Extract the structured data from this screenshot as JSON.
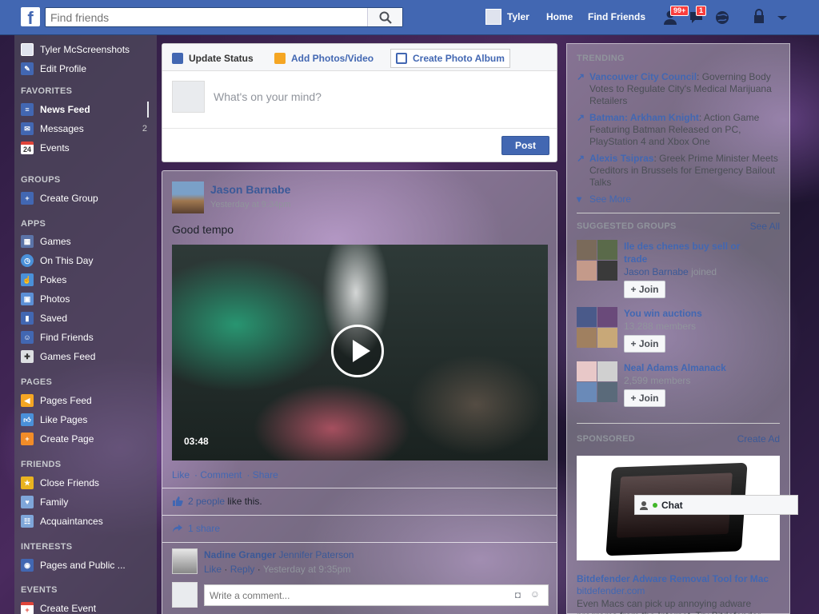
{
  "header": {
    "logo": "f",
    "search_placeholder": "Find friends",
    "user_name": "Tyler",
    "home": "Home",
    "find_friends": "Find Friends",
    "friend_requests_badge": "99+",
    "messages_badge": "1"
  },
  "sidebar": {
    "profile_name": "Tyler McScreenshots",
    "edit_profile": "Edit Profile",
    "favorites_heading": "FAVORITES",
    "favorites": [
      {
        "label": "News Feed",
        "icon": "news-feed-icon"
      },
      {
        "label": "Messages",
        "icon": "messages-icon",
        "count": "2"
      },
      {
        "label": "Events",
        "icon": "calendar-icon",
        "icon_text": "24"
      }
    ],
    "groups_heading": "GROUPS",
    "groups": [
      {
        "label": "Create Group",
        "icon": "plus-icon"
      }
    ],
    "apps_heading": "APPS",
    "apps": [
      {
        "label": "Games",
        "icon": "games-icon"
      },
      {
        "label": "On This Day",
        "icon": "clock-icon"
      },
      {
        "label": "Pokes",
        "icon": "poke-icon"
      },
      {
        "label": "Photos",
        "icon": "photos-icon"
      },
      {
        "label": "Saved",
        "icon": "bookmark-icon"
      },
      {
        "label": "Find Friends",
        "icon": "find-friends-icon"
      },
      {
        "label": "Games Feed",
        "icon": "gamepad-icon"
      }
    ],
    "pages_heading": "PAGES",
    "pages": [
      {
        "label": "Pages Feed",
        "icon": "megaphone-icon"
      },
      {
        "label": "Like Pages",
        "icon": "thumbs-up-icon"
      },
      {
        "label": "Create Page",
        "icon": "create-page-icon"
      }
    ],
    "friends_heading": "FRIENDS",
    "friends": [
      {
        "label": "Close Friends",
        "icon": "star-icon"
      },
      {
        "label": "Family",
        "icon": "family-icon"
      },
      {
        "label": "Acquaintances",
        "icon": "acquaintances-icon"
      }
    ],
    "interests_heading": "INTERESTS",
    "interests": [
      {
        "label": "Pages and Public ...",
        "icon": "rss-icon"
      }
    ],
    "events_heading": "EVENTS",
    "events": [
      {
        "label": "Create Event",
        "icon": "create-event-icon"
      }
    ]
  },
  "composer": {
    "tab_status": "Update Status",
    "tab_photos": "Add Photos/Video",
    "tab_album": "Create Photo Album",
    "placeholder": "What's on your mind?",
    "post_button": "Post"
  },
  "post": {
    "author": "Jason Barnabe",
    "time": "Yesterday at 9:34pm",
    "text": "Good tempo",
    "video_duration": "03:48",
    "actions": [
      "Like",
      "Comment",
      "Share"
    ],
    "likes_count": "2 people",
    "likes_suffix": " like this.",
    "shares": "1 share",
    "comment": {
      "author": "Nadine Granger",
      "mention": "Jennifer Paterson",
      "like": "Like",
      "reply": "Reply",
      "time": "Yesterday at 9:35pm"
    },
    "comment_placeholder": "Write a comment..."
  },
  "right": {
    "trending_heading": "TRENDING",
    "trending": [
      {
        "topic": "Vancouver City Council",
        "desc": ": Governing Body Votes to Regulate City's Medical Marijuana Retailers"
      },
      {
        "topic": "Batman: Arkham Knight",
        "desc": ": Action Game Featuring Batman Released on PC, PlayStation 4 and Xbox One"
      },
      {
        "topic": "Alexis Tsipras",
        "desc": ": Greek Prime Minister Meets Creditors in Brussels for Emergency Bailout Talks"
      }
    ],
    "see_more": "See More",
    "suggested_heading": "SUGGESTED GROUPS",
    "see_all": "See All",
    "groups": [
      {
        "name": "Ile des chenes buy sell or trade",
        "member": "Jason Barnabe",
        "sub": " joined"
      },
      {
        "name": "You win auctions",
        "member": "",
        "sub": "13,288 members"
      },
      {
        "name": "Neal Adams Almanack",
        "member": "",
        "sub": "2,599 members"
      }
    ],
    "join_label": "Join",
    "sponsored_heading": "SPONSORED",
    "create_ad": "Create Ad",
    "ad_title": "Bitdefender Adware Removal Tool for Mac",
    "ad_url": "bitdefender.com",
    "ad_desc": "Even Macs can pick up annoying adware programs from the Internet. Try Bitdefender"
  },
  "chat": {
    "label": "Chat"
  }
}
